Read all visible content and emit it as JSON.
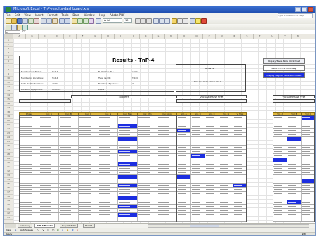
{
  "window": {
    "title": "Microsoft Excel - TnP-results-dashboard.xls",
    "controls": [
      "minimize",
      "maximize",
      "close"
    ]
  },
  "menu": {
    "items": [
      "File",
      "Edit",
      "View",
      "Insert",
      "Format",
      "Tools",
      "Data",
      "Window",
      "Help",
      "Adobe PDF"
    ],
    "help_placeholder": "Type a question for help"
  },
  "toolbar": {
    "font_name": "Arial",
    "font_size": "10"
  },
  "formula_bar": {
    "name_box": "A1",
    "fx_label": "fx"
  },
  "columns": [
    "A",
    "B",
    "C",
    "D",
    "E",
    "F",
    "G",
    "H",
    "I",
    "J",
    "K",
    "L",
    "M",
    "N",
    "O",
    "P",
    "Q",
    "R",
    "S",
    "T",
    "U",
    "V",
    "W"
  ],
  "report": {
    "title": "Results - TnP-4",
    "info_labels": [
      "Number and Name:",
      "Number of Localities:",
      "Date de l'Installation:",
      "Location Equipment:",
      "N Number EIL:",
      "Type de EIL:",
      "Number of phases:",
      "Ligne"
    ],
    "info_values": [
      "TnP-4",
      "TnP-4",
      "2010",
      "2010-01",
      "1234",
      "T-100",
      "3"
    ],
    "notes_title": "Remarks",
    "notes_date": "Mar-Apr 2011, 2010-2011"
  },
  "right_buttons": [
    {
      "label": "Display Trade Table Worksheet",
      "style": "plain"
    },
    {
      "label": "Return to the summary",
      "style": "plain"
    },
    {
      "label": "Display Regulat Table Worksheet",
      "style": "blue"
    }
  ],
  "sections": {
    "current": "CURRENT",
    "voltage_left": "VOLTAGE/PHASE TYPE",
    "voltage_right": "VOLTAGE/PHASE TYPE"
  },
  "table_headers": {
    "main": [
      "Phase",
      "Cur. A",
      "Cur. B",
      "Cur. C",
      "Cur. N",
      "Cur. Max",
      "Cur. Min",
      "Cur. Avg"
    ],
    "middle": [
      "Vol. A",
      "Vol. B",
      "Vol. C",
      "Vol. N",
      "V. Max"
    ],
    "right": [
      "Vol. A",
      "Vol. B",
      "Vol. C"
    ]
  },
  "sheet_tabs": [
    "Summary",
    "TnP-4 Results",
    "Regulat Table",
    "Sheet1"
  ],
  "active_tab_index": 1,
  "drawing_bar": {
    "draw_label": "Draw",
    "autoshapes_label": "AutoShapes"
  },
  "status": {
    "left": "Ready",
    "right": "NUM"
  },
  "colors": {
    "header_gold": "#e2b93e",
    "highlight_blue": "#1c2ee0",
    "titlebar_blue": "#1f4fb0"
  }
}
